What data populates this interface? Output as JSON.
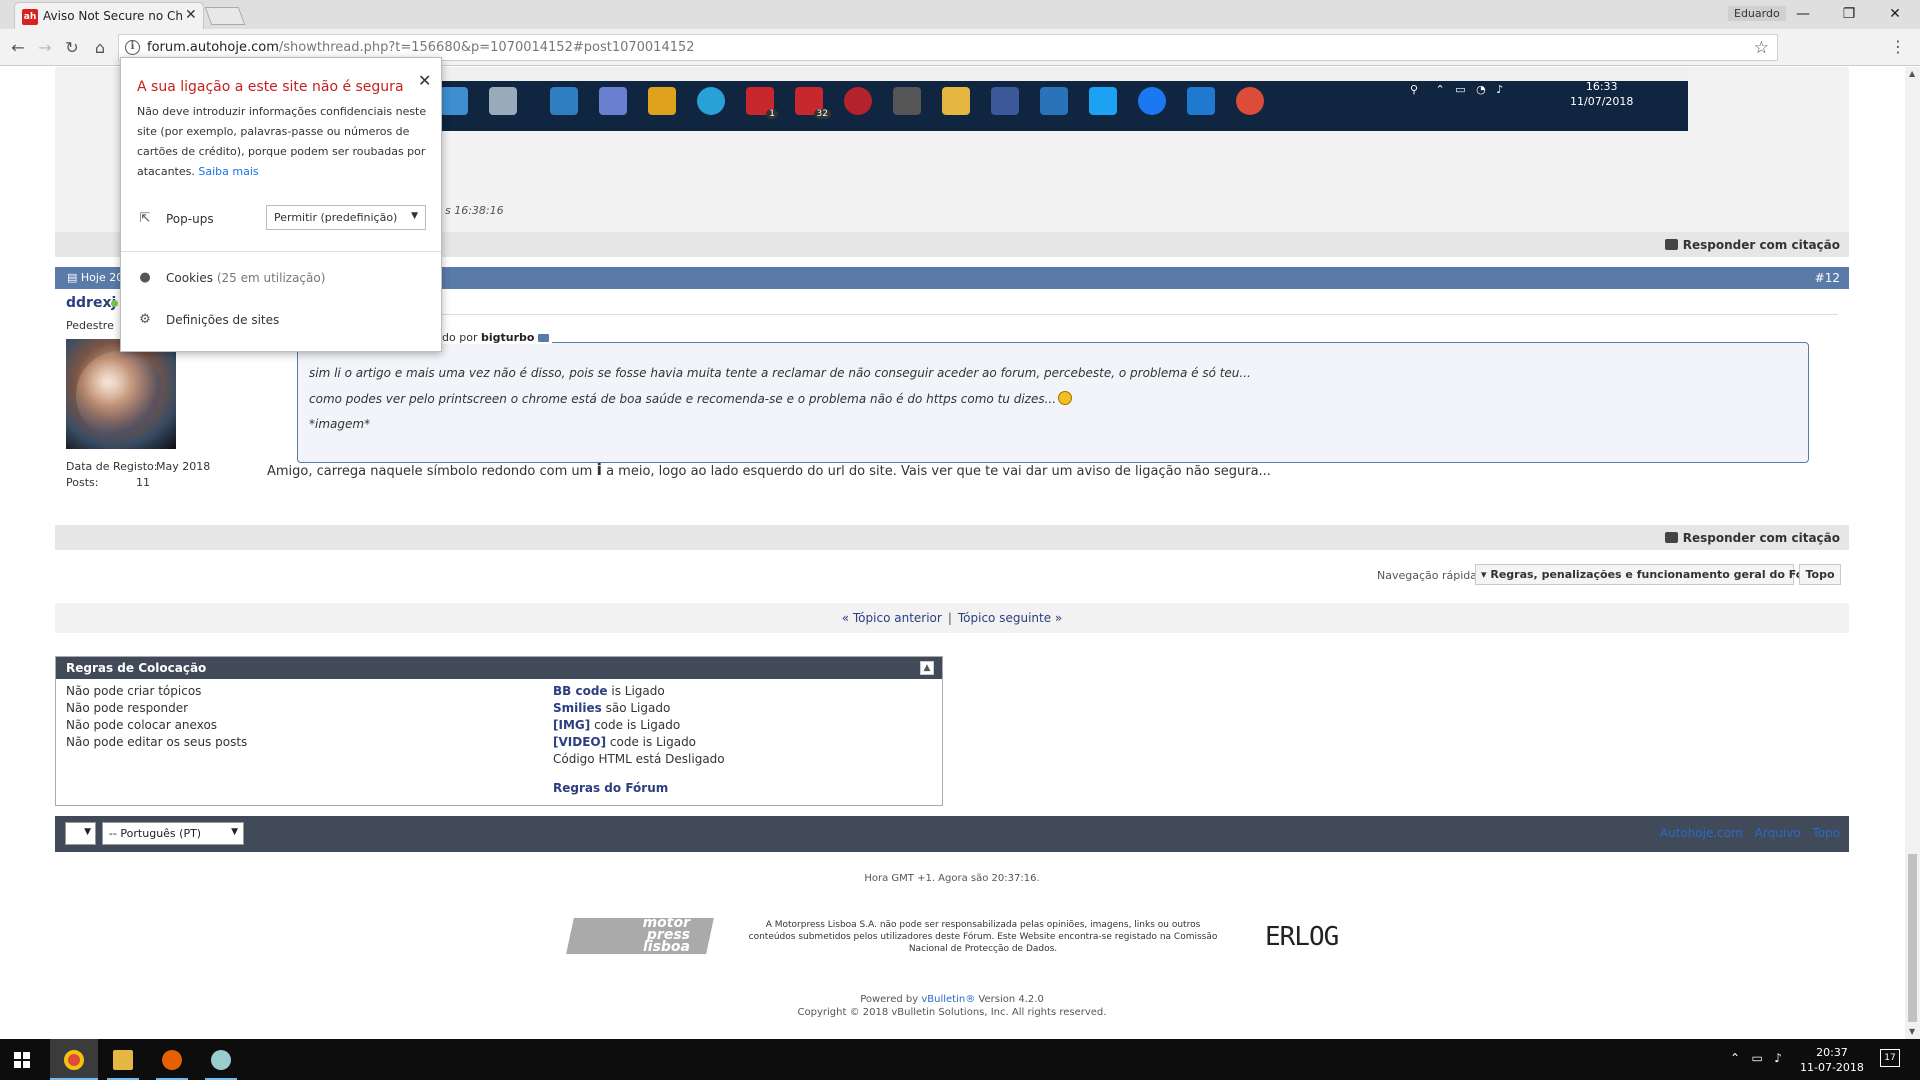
{
  "browser": {
    "tab_title": "Aviso Not Secure no Chrome",
    "tab_favicon": "ah",
    "window_user": "Eduardo",
    "url_host": "forum.autohoje.com",
    "url_path": "/showthread.php?t=156680&p=1070014152#post1070014152"
  },
  "popup": {
    "title": "A sua ligação a este site não é segura",
    "description": "Não deve introduzir informações confidenciais neste site (por exemplo, palavras-passe ou números de cartões de crédito), porque podem ser roubadas por atacantes.",
    "learn_more": "Saiba mais",
    "popups_label": "Pop-ups",
    "popups_value": "Permitir (predefinição)",
    "cookies_label": "Cookies",
    "cookies_count": "(25 em utilização)",
    "site_settings_label": "Definições de sites"
  },
  "prev_post": {
    "date_fragment": "s 16:38:16",
    "tray_time": "16:33",
    "tray_date": "11/07/2018",
    "badge_1": "1",
    "badge_32": "32"
  },
  "reply_label": "Responder com citação",
  "post": {
    "date": "Hoje 20",
    "number": "#12",
    "username": "ddrexj",
    "user_title": "Pedestre",
    "reg_label": "Data de Registo:",
    "reg_value": "May 2018",
    "posts_label": "Posts:",
    "posts_value": "11",
    "quote_head_prefix": "Originalmente Colocado por",
    "quote_author": "bigturbo",
    "quote_line1": "sim li o artigo e mais uma vez não é disso, pois se fosse havia muita tente a reclamar de não conseguir aceder ao forum, percebeste, o problema é só teu...",
    "quote_line2": "como podes ver pelo printscreen o chrome está de boa saúde e recomenda-se e o problema não é do https como tu dizes...",
    "quote_line3": "*imagem*",
    "message_before": "Amigo, carrega naquele símbolo redondo com um",
    "message_symbol": "i",
    "message_after": "a meio, logo ao lado esquerdo do url do site. Vais ver que te vai dar um aviso de ligação não segura..."
  },
  "navigation": {
    "quick_nav_label": "Navegação rápida",
    "quick_nav_value": "Regras, penalizações e funcionamento geral do Fórum",
    "top_button": "Topo",
    "prev_thread": "« Tópico anterior",
    "separator": "|",
    "next_thread": "Tópico seguinte »"
  },
  "rules": {
    "title": "Regras de Colocação",
    "left": [
      "Não pode criar tópicos",
      "Não pode responder",
      "Não pode colocar anexos",
      "Não pode editar os seus posts"
    ],
    "right": [
      {
        "key": "BB code",
        "text": "is Ligado"
      },
      {
        "key": "Smilies",
        "text": "são Ligado"
      },
      {
        "key": "[IMG]",
        "text": "code is Ligado"
      },
      {
        "key": "[VIDEO]",
        "text": "code is Ligado"
      },
      {
        "key": "",
        "text": "Código HTML está Desligado"
      }
    ],
    "forum_rules_link": "Regras do Fórum"
  },
  "footer": {
    "language": "-- Português (PT)",
    "links": [
      "Autohoje.com",
      "Arquivo",
      "Topo"
    ],
    "gmt": "Hora GMT +1. Agora são 20:37:16.",
    "logo_text": [
      "motor",
      "press",
      "lisboa"
    ],
    "disclaimer": "A Motorpress Lisboa S.A. não pode ser responsabilizada pelas opiniões, imagens, links ou outros conteúdos submetidos pelos utilizadores deste Fórum. Este Website encontra-se registado na Comissão Nacional de Protecção de Dados.",
    "erlog": "ERLOG",
    "powered_prefix": "Powered by",
    "powered_brand": "vBulletin®",
    "powered_version": "Version 4.2.0",
    "copyright": "Copyright © 2018 vBulletin Solutions, Inc. All rights reserved."
  },
  "taskbar": {
    "time": "20:37",
    "date": "11-07-2018",
    "notifications": "17"
  }
}
